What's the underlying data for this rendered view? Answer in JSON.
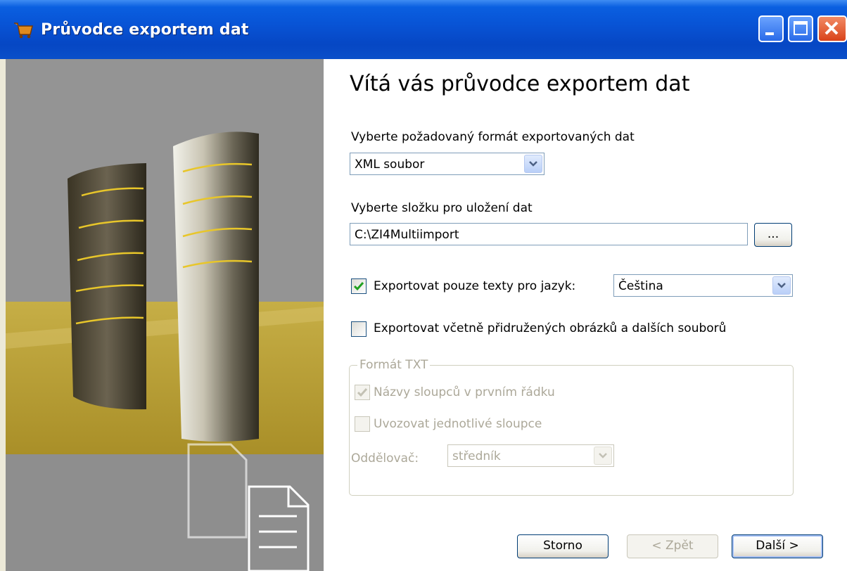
{
  "window": {
    "title": "Průvodce exportem dat"
  },
  "heading": "Vítá vás průvodce exportem dat",
  "format": {
    "label": "Vyberte požadovaný formát exportovaných dat",
    "selected": "XML soubor"
  },
  "folder": {
    "label": "Vyberte složku pro uložení dat",
    "value": "C:\\ZI4Multiimport",
    "browse_label": "..."
  },
  "language_filter": {
    "label": "Exportovat pouze texty pro jazyk:",
    "checked": true,
    "selected": "Čeština"
  },
  "include_files": {
    "label": "Exportovat včetně přidružených obrázků a dalších souborů",
    "checked": false
  },
  "txt_group": {
    "title": "Formát TXT",
    "column_names": {
      "label": "Názvy sloupců v prvním řádku",
      "checked": true
    },
    "quote_columns": {
      "label": "Uvozovat jednotlivé sloupce",
      "checked": false
    },
    "separator": {
      "label": "Oddělovač:",
      "selected": "středník"
    }
  },
  "buttons": {
    "cancel": "Storno",
    "back": "< Zpět",
    "next": "Další >"
  }
}
